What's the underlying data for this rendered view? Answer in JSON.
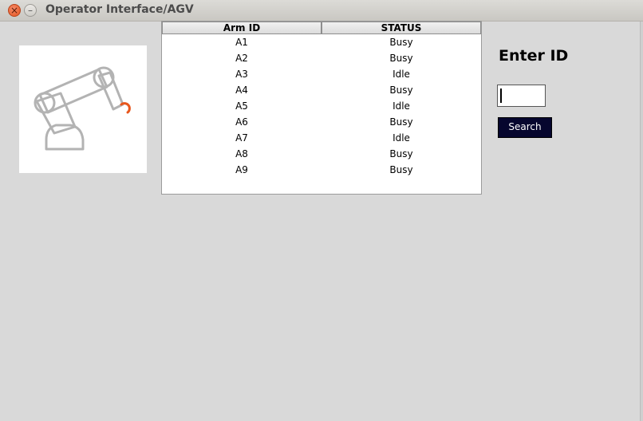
{
  "window": {
    "title": "Operator Interface/AGV"
  },
  "table": {
    "headers": [
      "Arm ID",
      "STATUS"
    ],
    "rows": [
      [
        "A1",
        "Busy"
      ],
      [
        "A2",
        "Busy"
      ],
      [
        "A3",
        "Idle"
      ],
      [
        "A4",
        "Busy"
      ],
      [
        "A5",
        "Idle"
      ],
      [
        "A6",
        "Busy"
      ],
      [
        "A7",
        "Idle"
      ],
      [
        "A8",
        "Busy"
      ],
      [
        "A9",
        "Busy"
      ]
    ]
  },
  "search": {
    "label": "Enter ID",
    "input_value": "",
    "button_label": "Search"
  },
  "icons": {
    "close": "close-icon",
    "minimize": "minimize-icon",
    "robot": "robot-arm-icon"
  },
  "colors": {
    "accent_gripper": "#e8561c",
    "search_button_bg": "#06062e",
    "titlebar_close": "#e4541e"
  }
}
